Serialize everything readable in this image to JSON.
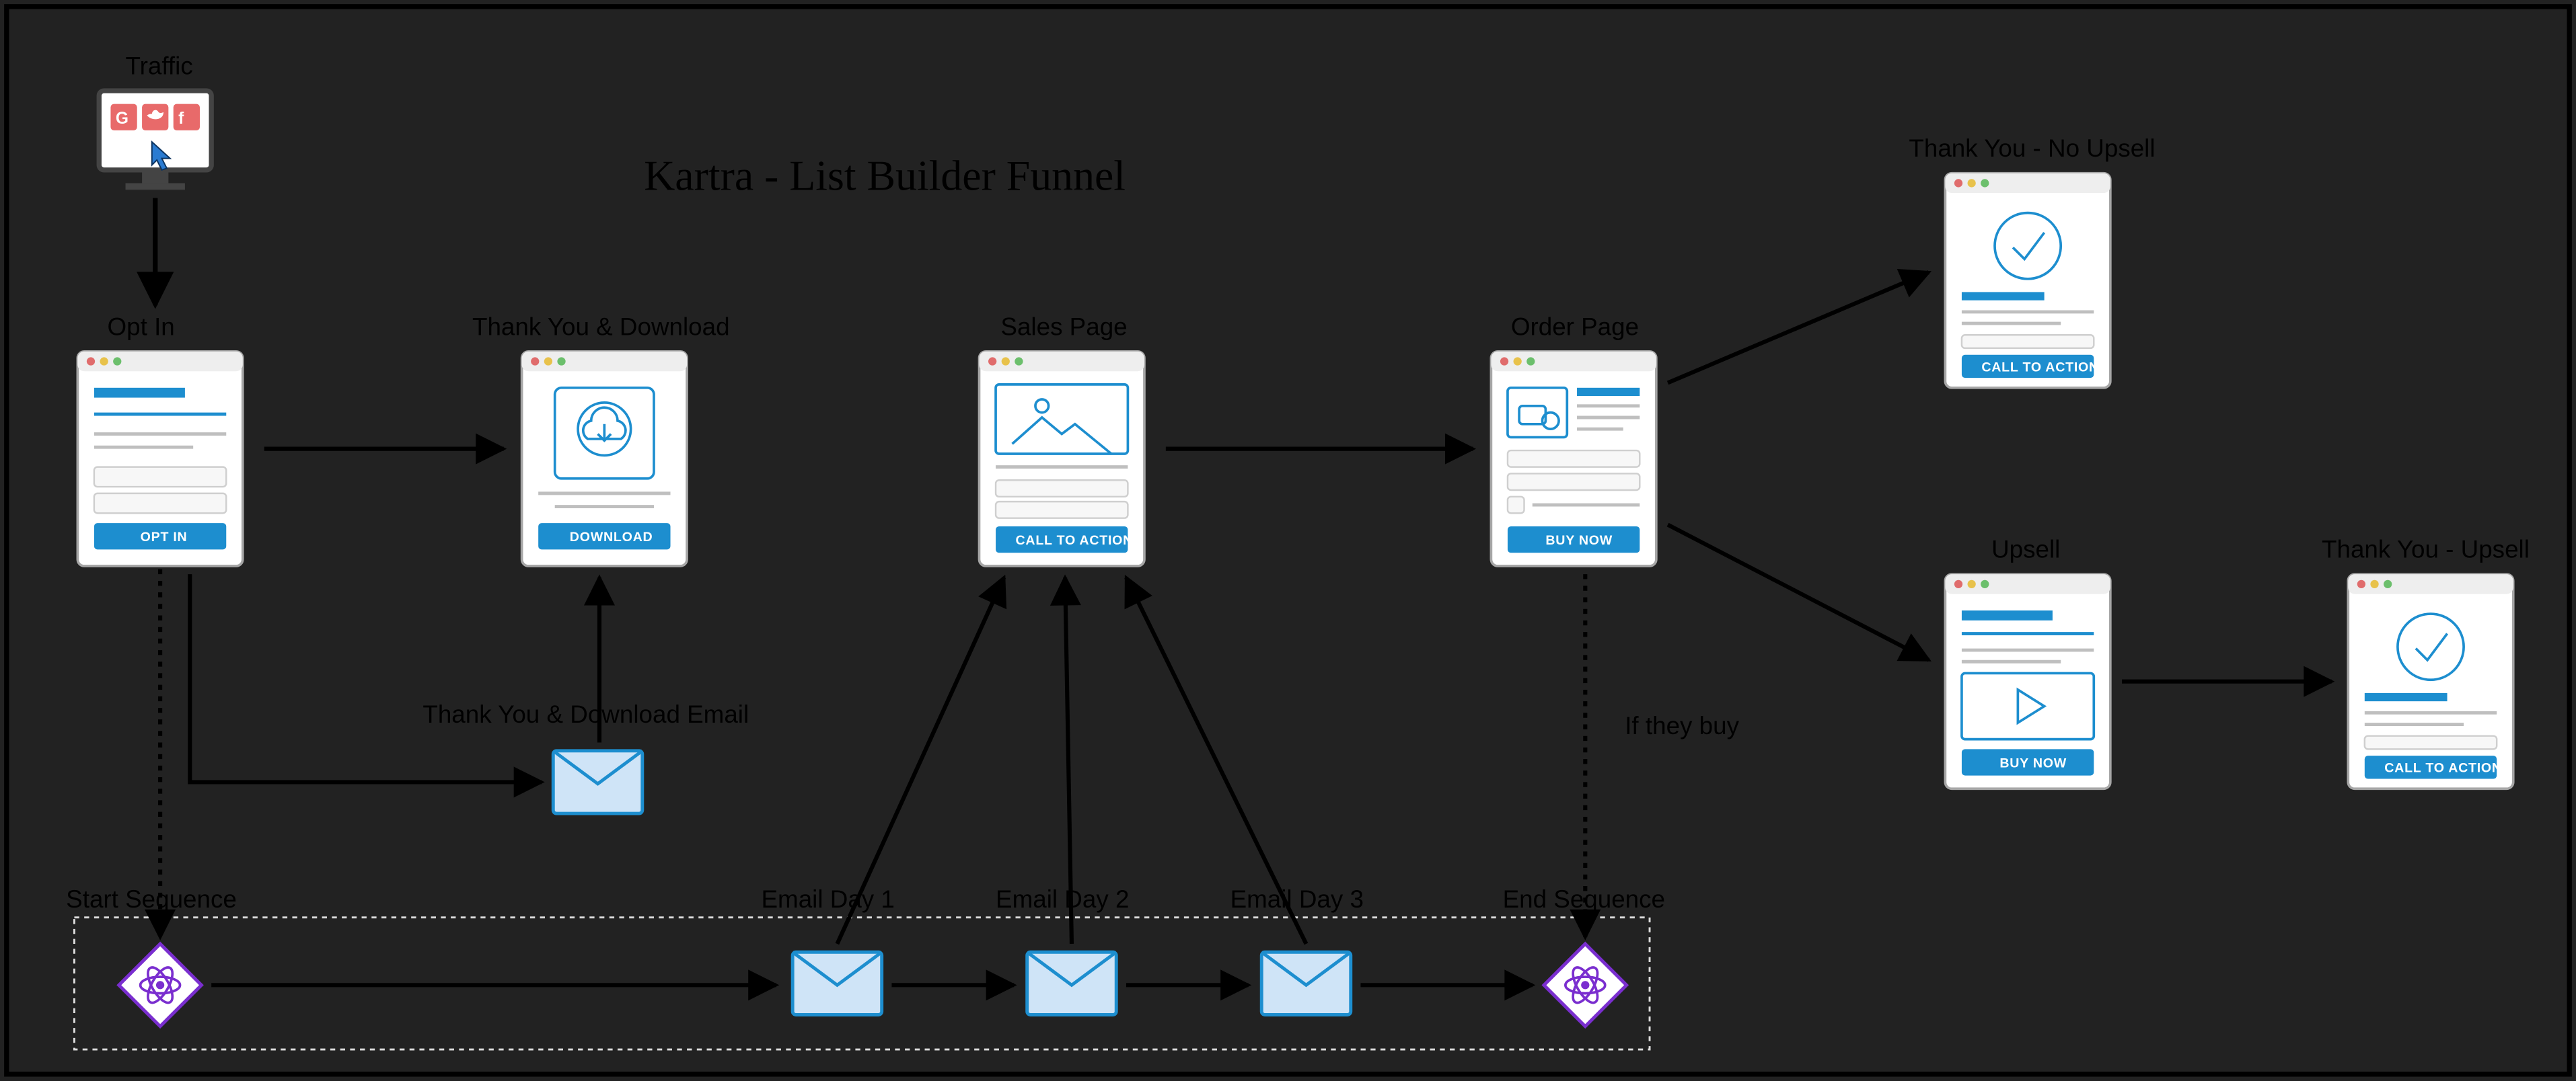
{
  "title": "Kartra - List Builder Funnel",
  "labels": {
    "traffic": "Traffic",
    "optin": "Opt In",
    "thankyou_download": "Thank You & Download",
    "sales": "Sales Page",
    "order": "Order Page",
    "ty_noupsell": "Thank You - No Upsell",
    "upsell": "Upsell",
    "ty_upsell": "Thank You - Upsell",
    "ty_dl_email": "Thank You & Download Email",
    "if_they_buy": "If they buy",
    "start_seq": "Start Sequence",
    "end_seq": "End Sequence",
    "email_day1": "Email Day 1",
    "email_day2": "Email Day 2",
    "email_day3": "Email Day 3"
  },
  "cta": {
    "optin": "OPT IN",
    "download": "DOWNLOAD",
    "call_to_action": "CALL TO ACTION",
    "buy_now": "BUY NOW"
  }
}
